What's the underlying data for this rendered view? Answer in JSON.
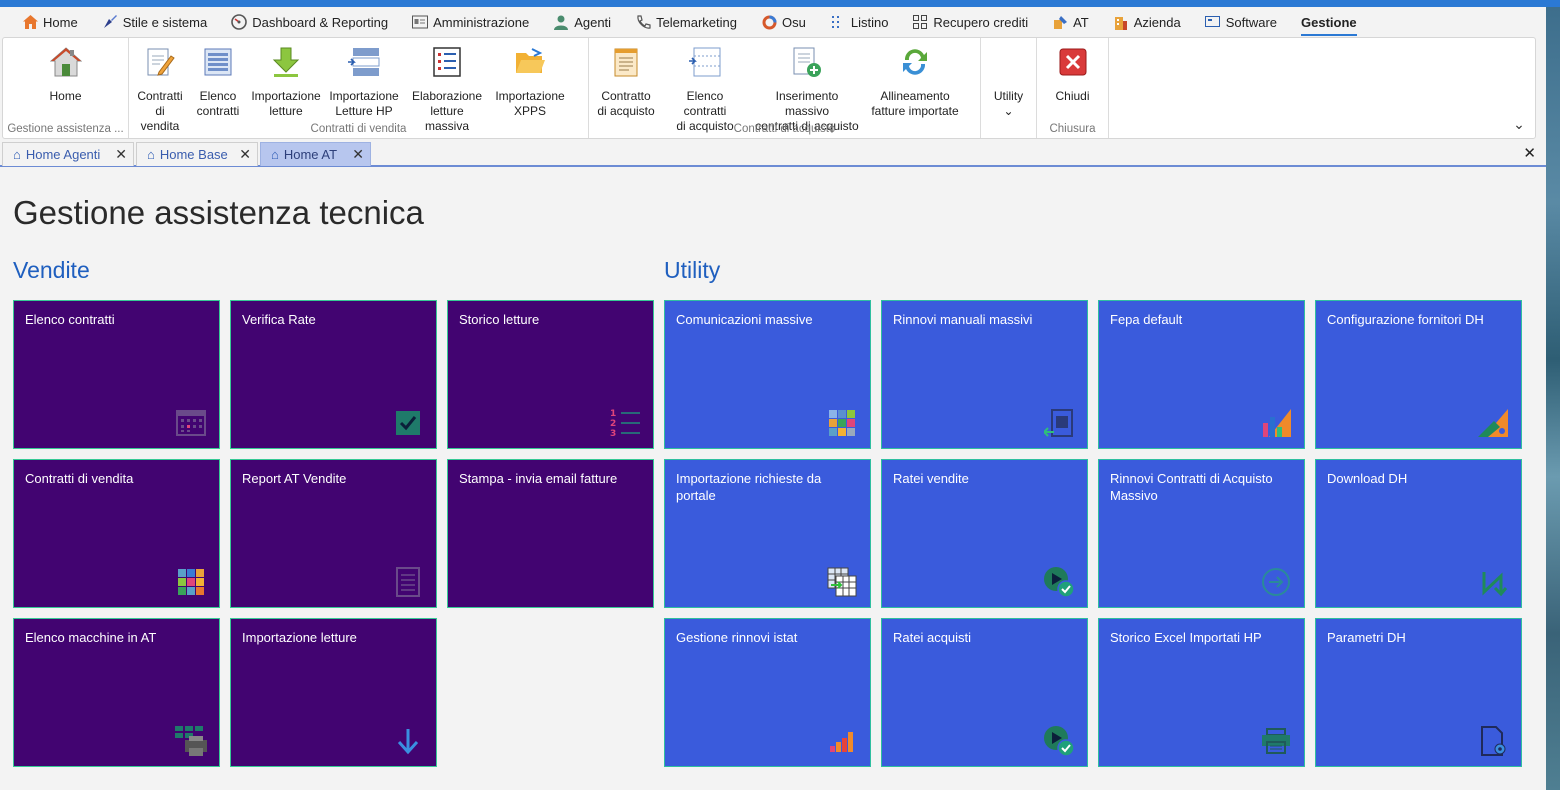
{
  "menubar": {
    "items": [
      {
        "label": "Home",
        "icon": "home-icon"
      },
      {
        "label": "Stile e sistema",
        "icon": "brush-icon"
      },
      {
        "label": "Dashboard & Reporting",
        "icon": "gauge-icon"
      },
      {
        "label": "Amministrazione",
        "icon": "id-card-icon"
      },
      {
        "label": "Agenti",
        "icon": "person-icon"
      },
      {
        "label": "Telemarketing",
        "icon": "phone-icon"
      },
      {
        "label": "Osu",
        "icon": "ring-icon"
      },
      {
        "label": "Listino",
        "icon": "dots-grid-icon"
      },
      {
        "label": "Recupero crediti",
        "icon": "grid-icon"
      },
      {
        "label": "AT",
        "icon": "wrench-icon"
      },
      {
        "label": "Azienda",
        "icon": "building-icon"
      },
      {
        "label": "Software",
        "icon": "monitor-icon"
      },
      {
        "label": "Gestione",
        "icon": ""
      }
    ]
  },
  "ribbon": {
    "groups": [
      {
        "label": "Gestione assistenza ...",
        "buttons": [
          {
            "label": "Home",
            "icon": "house-icon"
          }
        ]
      },
      {
        "label": "Contratti di vendita",
        "buttons": [
          {
            "label": "Contratti\ndi vendita",
            "icon": "document-pencil-icon"
          },
          {
            "label": "Elenco\ncontratti",
            "icon": "list-document-icon"
          },
          {
            "label": "Importazione\nletture",
            "icon": "download-arrow-icon"
          },
          {
            "label": "Importazione\nLetture HP",
            "icon": "list-lines-icon"
          },
          {
            "label": "Elaborazione\nletture massiva",
            "icon": "checklist-icon"
          },
          {
            "label": "Importazione\nXPPS",
            "icon": "folder-open-icon"
          }
        ]
      },
      {
        "label": "Contratti di acquisto",
        "buttons": [
          {
            "label": "Contratto\ndi acquisto",
            "icon": "notepad-icon"
          },
          {
            "label": "Elenco contratti\ndi acquisto",
            "icon": "list-frame-icon"
          },
          {
            "label": "Inserimento massivo\ncontratti di acquisto",
            "icon": "document-add-icon"
          },
          {
            "label": "Allineamento\nfatture importate",
            "icon": "refresh-icon"
          }
        ]
      },
      {
        "label": "",
        "buttons": [
          {
            "label": "Utility\n⌄",
            "icon": ""
          }
        ]
      },
      {
        "label": "Chiusura",
        "buttons": [
          {
            "label": "Chiudi",
            "icon": "close-red-icon"
          }
        ]
      }
    ]
  },
  "tabs": [
    {
      "label": "Home Agenti"
    },
    {
      "label": "Home Base"
    },
    {
      "label": "Home AT"
    }
  ],
  "page": {
    "title": "Gestione assistenza tecnica",
    "vendite_title": "Vendite",
    "utility_title": "Utility"
  },
  "vendite_tiles": [
    {
      "label": "Elenco contratti",
      "icon": "calendar-icon"
    },
    {
      "label": "Verifica Rate",
      "icon": "checkbox-icon"
    },
    {
      "label": "Storico letture",
      "icon": "numbered-list-icon"
    },
    {
      "label": "Contratti di vendita",
      "icon": "color-grid-icon"
    },
    {
      "label": "Report AT Vendite",
      "icon": "document-lines-icon"
    },
    {
      "label": "Stampa - invia email fatture",
      "icon": ""
    },
    {
      "label": "Elenco macchine in AT",
      "icon": "printer-grid-icon"
    },
    {
      "label": "Importazione letture",
      "icon": "arrow-down-icon"
    }
  ],
  "utility_tiles": [
    {
      "label": "Comunicazioni massive",
      "icon": "color-grid-icon"
    },
    {
      "label": "Rinnovi manuali massivi",
      "icon": "import-box-icon"
    },
    {
      "label": "Fepa default",
      "icon": "chart-triangle-icon"
    },
    {
      "label": "Configurazione fornitori DH",
      "icon": "triangle-ruler-icon"
    },
    {
      "label": "Importazione richieste da portale",
      "icon": "table-import-icon"
    },
    {
      "label": "Ratei vendite",
      "icon": "play-check-icon"
    },
    {
      "label": "Rinnovi Contratti di Acquisto Massivo",
      "icon": "arrow-circle-icon"
    },
    {
      "label": "Download DH",
      "icon": "download-n-icon"
    },
    {
      "label": "Gestione rinnovi istat",
      "icon": "bar-chart-icon"
    },
    {
      "label": "Ratei acquisti",
      "icon": "play-check-icon"
    },
    {
      "label": "Storico Excel Importati HP",
      "icon": "printer-icon"
    },
    {
      "label": "Parametri DH",
      "icon": "document-gear-icon"
    }
  ]
}
